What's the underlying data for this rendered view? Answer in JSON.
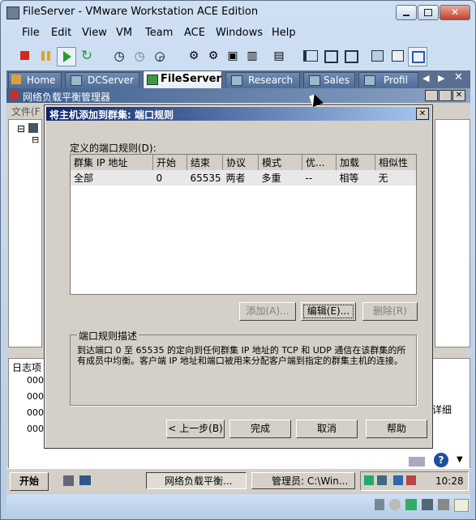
{
  "window": {
    "title": "FileServer - VMware Workstation ACE Edition"
  },
  "menu": [
    "File",
    "Edit",
    "View",
    "VM",
    "Team",
    "ACE",
    "Windows",
    "Help"
  ],
  "tabs": [
    {
      "label": "Home",
      "active": false
    },
    {
      "label": "DCServer",
      "active": false
    },
    {
      "label": "FileServer",
      "active": true
    },
    {
      "label": "Research",
      "active": false
    },
    {
      "label": "Sales",
      "active": false
    },
    {
      "label": "Profil",
      "active": false
    }
  ],
  "guest": {
    "nlb_title": "网络负载平衡管理器",
    "nlb_menu_file": "文件(F",
    "log_label": "日志项",
    "log_items": [
      "000",
      "000",
      "000",
      "000"
    ],
    "detail_label": "详细",
    "taskbar": {
      "start": "开始",
      "items": [
        "网络负载平衡...",
        "管理员: C:\\Win..."
      ],
      "clock": "10:28"
    }
  },
  "dialog": {
    "title": "将主机添加到群集:  端口规则",
    "rules_label": "定义的端口规则(D):",
    "columns": [
      "群集 IP 地址",
      "开始",
      "结束",
      "协议",
      "模式",
      "优...",
      "加载",
      "相似性"
    ],
    "rows": [
      [
        "全部",
        "0",
        "65535",
        "两者",
        "多重",
        "--",
        "相等",
        "无"
      ]
    ],
    "add_button": "添加(A)...",
    "edit_button": "编辑(E)...",
    "remove_button": "删除(R)",
    "desc_group": "端口规则描述",
    "desc_text": "到达端口 0 至 65535 的定向到任何群集 IP 地址的 TCP 和 UDP 通信在该群集的所有成员中均衡。客户端 IP 地址和端口被用来分配客户端到指定的群集主机的连接。",
    "back_button": "< 上一步(B)",
    "finish_button": "完成",
    "cancel_button": "取消",
    "help_button": "帮助"
  }
}
